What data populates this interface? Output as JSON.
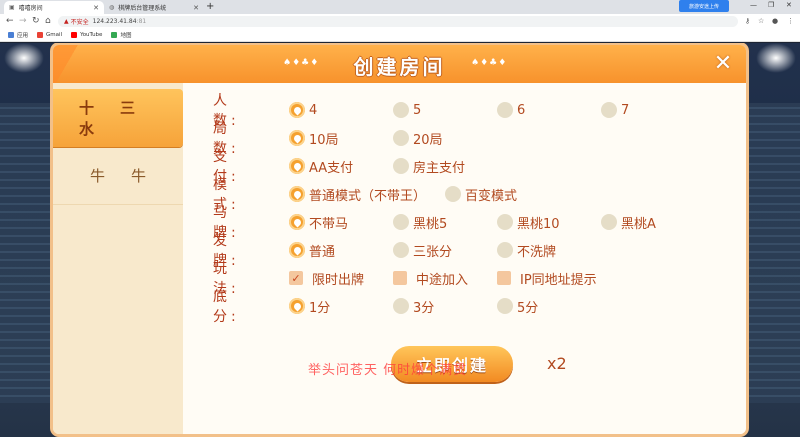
{
  "browser": {
    "tabs": [
      {
        "title": "嘻嘻房间",
        "active": true
      },
      {
        "title": "棋牌后台管理系统",
        "active": false
      }
    ],
    "new_tab": "+",
    "extension_label": "旅游安途上传",
    "security_label": "不安全",
    "url": "124.223.41.84",
    "url_port": ":81",
    "bookmarks": [
      "应用",
      "Gmail",
      "YouTube",
      "地图"
    ]
  },
  "dialog": {
    "title": "创建房间",
    "diamonds_left": "♠♦♣♦",
    "diamonds_right": "♠♦♣♦",
    "close_label": "✕"
  },
  "sidebar": {
    "items": [
      {
        "label": "十三水",
        "active": true
      },
      {
        "label": "牛牛",
        "active": false
      }
    ]
  },
  "options": [
    {
      "label": "人　数:",
      "choices": [
        {
          "text": "4",
          "selected": true
        },
        {
          "text": "5"
        },
        {
          "text": "6"
        },
        {
          "text": "7"
        }
      ]
    },
    {
      "label": "局　数:",
      "choices": [
        {
          "text": "10局",
          "selected": true
        },
        {
          "text": "20局"
        }
      ]
    },
    {
      "label": "支　付:",
      "choices": [
        {
          "text": "AA支付",
          "selected": true
        },
        {
          "text": "房主支付"
        }
      ]
    },
    {
      "label": "模　式:",
      "choices": [
        {
          "text": "普通模式（不带王）",
          "selected": true
        },
        {
          "text": "百变模式"
        }
      ]
    },
    {
      "label": "马　牌:",
      "choices": [
        {
          "text": "不带马",
          "selected": true
        },
        {
          "text": "黑桃5"
        },
        {
          "text": "黑桃10"
        },
        {
          "text": "黑桃A"
        }
      ]
    },
    {
      "label": "发　牌:",
      "choices": [
        {
          "text": "普通",
          "selected": true
        },
        {
          "text": "三张分"
        },
        {
          "text": "不洗牌"
        }
      ]
    },
    {
      "label": "玩　法:",
      "checks": [
        {
          "text": "限时出牌",
          "checked": true
        },
        {
          "text": "中途加入"
        },
        {
          "text": "IP同地址提示"
        }
      ]
    },
    {
      "label": "底　分:",
      "choices": [
        {
          "text": "1分",
          "selected": true
        },
        {
          "text": "3分"
        },
        {
          "text": "5分"
        }
      ]
    }
  ],
  "create_button": "立即创建",
  "cost": "x2",
  "watermark": "举头问苍天 何时爆个满贯"
}
